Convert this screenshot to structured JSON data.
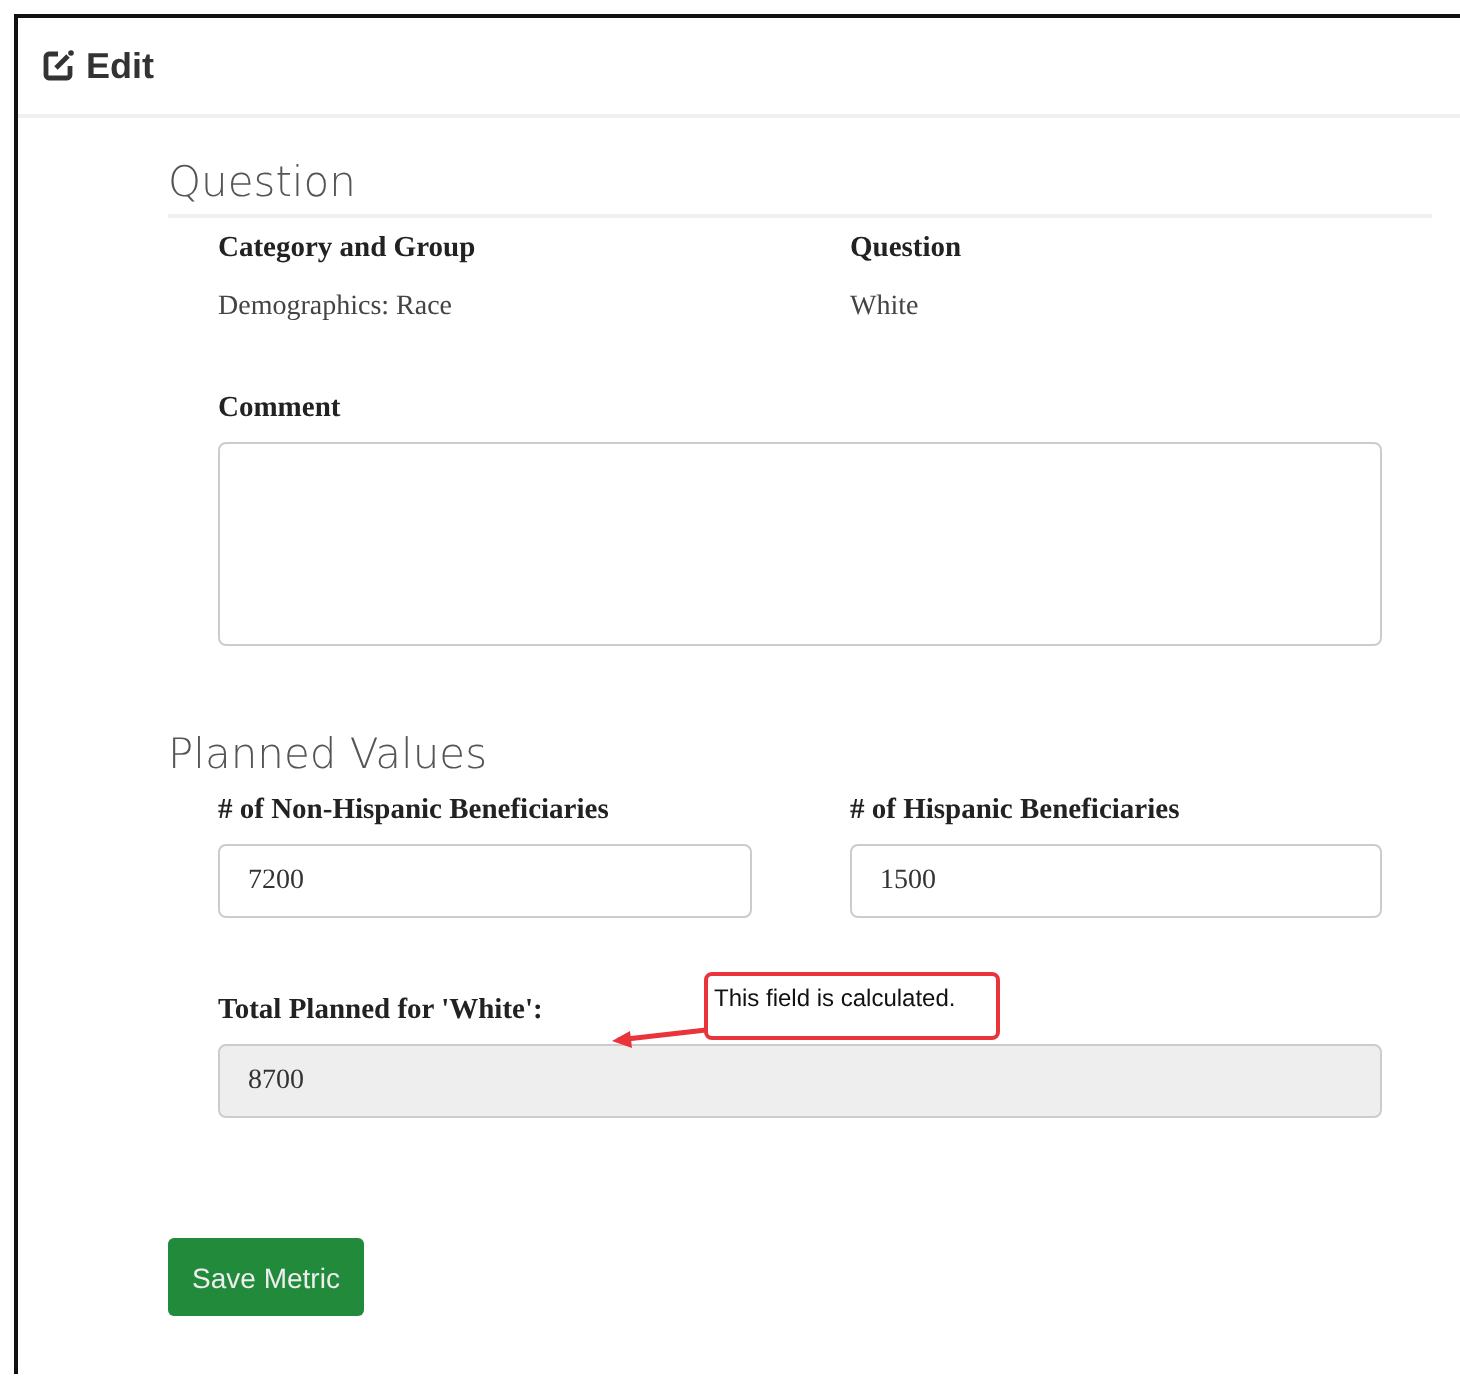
{
  "header": {
    "title": "Edit"
  },
  "question_section": {
    "heading": "Question",
    "fields": [
      {
        "label": "Category and Group",
        "value": "Demographics: Race"
      },
      {
        "label": "Question",
        "value": "White"
      }
    ],
    "comment": {
      "label": "Comment"
    }
  },
  "planned_values": {
    "heading": "Planned Values",
    "inputs": [
      {
        "label": "# of Non-Hispanic Beneficiaries",
        "value": "7200"
      },
      {
        "label": "# of Hispanic Beneficiaries",
        "value": "1500"
      }
    ],
    "total": {
      "label": "Total Planned for 'White':",
      "value": "8700",
      "disabled": true
    },
    "callout": "This field is calculated."
  },
  "buttons": [
    {
      "label": "Save Metric"
    }
  ]
}
